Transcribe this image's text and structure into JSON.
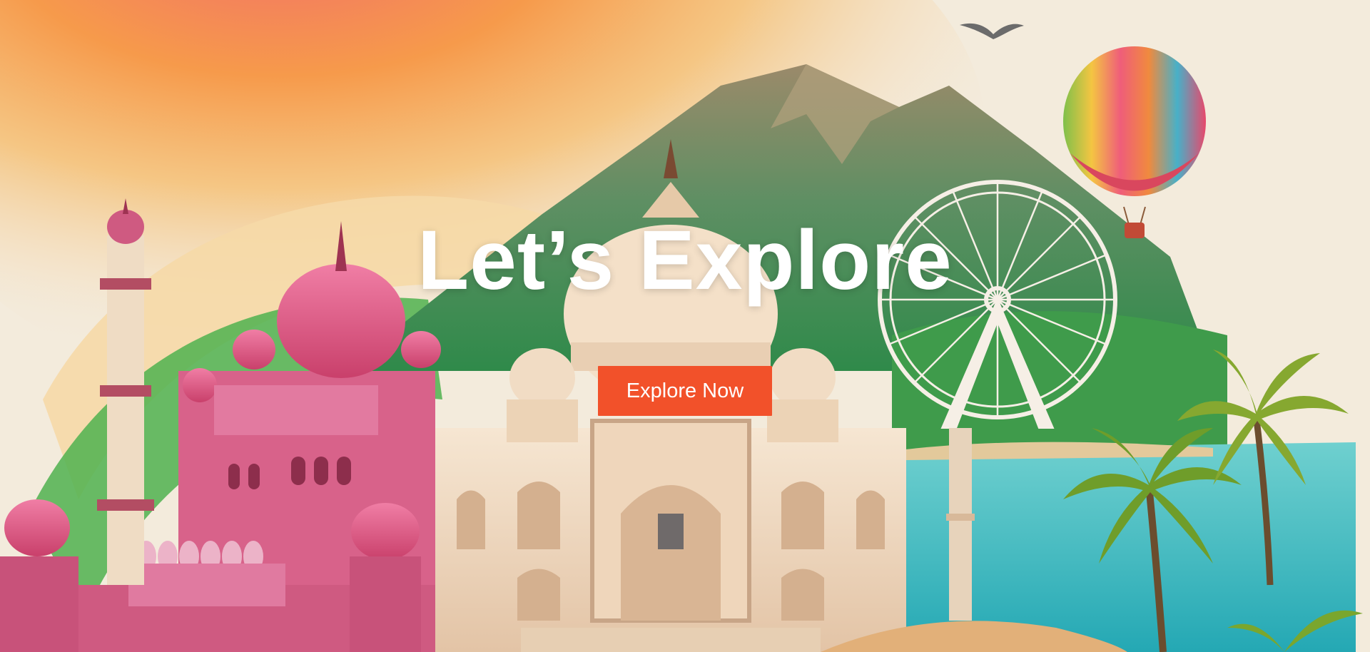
{
  "hero": {
    "title": "Let’s Explore",
    "cta_label": "Explore Now",
    "background_scene": "india-travel-collage",
    "colors": {
      "cta": "#f2512a",
      "title": "#ffffff",
      "saffron": "#f39a3c",
      "green": "#3fa84a",
      "pink_palace": "#d9587f",
      "marble": "#f1ddc6",
      "lake": "#3bbcc3"
    }
  }
}
